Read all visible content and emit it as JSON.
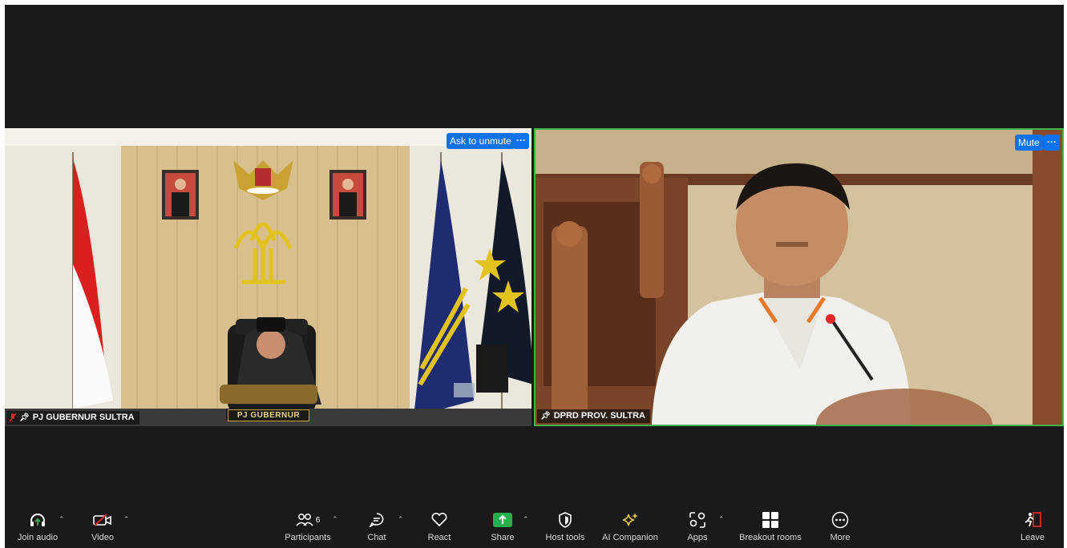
{
  "tiles": {
    "left": {
      "name": "PJ GUBERNUR SULTRA",
      "action_label": "Ask to unmute",
      "more_label": "···",
      "desk_sign": "PJ GUBERNUR"
    },
    "right": {
      "name": "DPRD PROV. SULTRA",
      "action_label": "Mute",
      "more_label": "···"
    }
  },
  "toolbar": {
    "join_audio": "Join audio",
    "video": "Video",
    "participants": "Participants",
    "participants_count": "6",
    "chat": "Chat",
    "react": "React",
    "share": "Share",
    "host_tools": "Host tools",
    "ai_companion": "AI Companion",
    "apps": "Apps",
    "breakout_rooms": "Breakout rooms",
    "more": "More",
    "leave": "Leave"
  },
  "colors": {
    "accent": "#0e72ed",
    "active_speaker_border": "#3fb24a",
    "share_green": "#22b14c",
    "leave_red": "#e02828",
    "ai_yellow": "#e8c547"
  }
}
